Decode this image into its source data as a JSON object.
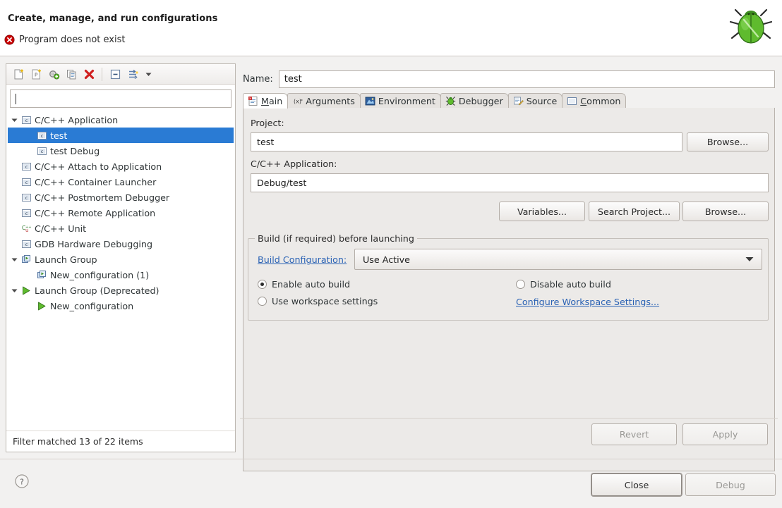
{
  "header": {
    "title": "Create, manage, and run configurations",
    "status_message": "Program does not exist",
    "error_icon": "error-circle-icon",
    "decoration_icon": "green-bug-icon"
  },
  "left_panel": {
    "toolbar": [
      {
        "name": "new-launch-configuration",
        "icon": "new-config-icon",
        "tooltip": "New launch configuration"
      },
      {
        "name": "new-prototype",
        "icon": "new-prototype-icon",
        "tooltip": "New prototype"
      },
      {
        "name": "export-configuration",
        "icon": "link-prototype-icon",
        "tooltip": "Link prototype"
      },
      {
        "name": "duplicate-configuration",
        "icon": "duplicate-icon",
        "tooltip": "Duplicate"
      },
      {
        "name": "delete-configuration",
        "icon": "delete-icon",
        "tooltip": "Delete"
      },
      {
        "name": "collapse-all",
        "icon": "collapse-all-icon",
        "tooltip": "Collapse All"
      },
      {
        "name": "filter-configurations",
        "icon": "filter-icon",
        "tooltip": "Filter"
      },
      {
        "name": "view-menu",
        "icon": "chevron-down-icon",
        "tooltip": "View Menu"
      }
    ],
    "filter_input": {
      "value": "",
      "placeholder": ""
    },
    "tree": [
      {
        "label": "C/C++ Application",
        "icon": "c-app-icon",
        "indent": 0,
        "twisty": "down",
        "selected": false
      },
      {
        "label": "test",
        "icon": "c-app-icon",
        "indent": 1,
        "twisty": "none",
        "selected": true
      },
      {
        "label": "test Debug",
        "icon": "c-app-icon",
        "indent": 1,
        "twisty": "none",
        "selected": false
      },
      {
        "label": "C/C++ Attach to Application",
        "icon": "c-app-icon",
        "indent": 0,
        "twisty": "none",
        "selected": false
      },
      {
        "label": "C/C++ Container Launcher",
        "icon": "c-app-icon",
        "indent": 0,
        "twisty": "none",
        "selected": false
      },
      {
        "label": "C/C++ Postmortem Debugger",
        "icon": "c-app-icon",
        "indent": 0,
        "twisty": "none",
        "selected": false
      },
      {
        "label": "C/C++ Remote Application",
        "icon": "c-app-icon",
        "indent": 0,
        "twisty": "none",
        "selected": false
      },
      {
        "label": "C/C++ Unit",
        "icon": "cunit-icon",
        "indent": 0,
        "twisty": "none",
        "selected": false
      },
      {
        "label": "GDB Hardware Debugging",
        "icon": "c-app-icon",
        "indent": 0,
        "twisty": "none",
        "selected": false
      },
      {
        "label": "Launch Group",
        "icon": "launch-group-icon",
        "indent": 0,
        "twisty": "down",
        "selected": false
      },
      {
        "label": "New_configuration (1)",
        "icon": "launch-group-icon",
        "indent": 1,
        "twisty": "none",
        "selected": false
      },
      {
        "label": "Launch Group (Deprecated)",
        "icon": "run-arrow-icon",
        "indent": 0,
        "twisty": "down",
        "selected": false
      },
      {
        "label": "New_configuration",
        "icon": "run-arrow-icon",
        "indent": 1,
        "twisty": "none",
        "selected": false
      }
    ],
    "status": "Filter matched 13 of 22 items"
  },
  "right_panel": {
    "name_label": "Name:",
    "name_value": "test",
    "tabs": [
      {
        "label": "Main",
        "mnemonic": "M",
        "icon": "main-tab-icon",
        "active": true
      },
      {
        "label": "Arguments",
        "mnemonic": "",
        "icon": "arguments-tab-icon",
        "active": false
      },
      {
        "label": "Environment",
        "mnemonic": "",
        "icon": "environment-tab-icon",
        "active": false
      },
      {
        "label": "Debugger",
        "mnemonic": "",
        "icon": "debugger-tab-icon",
        "active": false
      },
      {
        "label": "Source",
        "mnemonic": "",
        "icon": "source-tab-icon",
        "active": false
      },
      {
        "label": "Common",
        "mnemonic": "C",
        "icon": "common-tab-icon",
        "active": false
      }
    ],
    "main_tab": {
      "project_label": "Project:",
      "project_value": "test",
      "project_browse_label": "Browse...",
      "application_label": "C/C++ Application:",
      "application_value": "Debug/test",
      "variables_label": "Variables...",
      "search_project_label": "Search Project...",
      "app_browse_label": "Browse...",
      "build_group_title": "Build (if required) before launching",
      "build_configuration_link": "Build Configuration:",
      "build_configuration_value": "Use Active",
      "radio_enable_auto_build": "Enable auto build",
      "radio_disable_auto_build": "Disable auto build",
      "radio_use_workspace_settings": "Use workspace settings",
      "configure_workspace_link": "Configure Workspace Settings...",
      "selected_radio": "Enable auto build"
    },
    "revert_label": "Revert",
    "apply_label": "Apply"
  },
  "footer": {
    "help_icon": "help-question-icon",
    "close_label": "Close",
    "debug_label": "Debug"
  },
  "colors": {
    "selection_blue": "#2a7bd4",
    "link_blue": "#2a62b4",
    "error_red": "#cc0000",
    "dialog_bg": "#f2f1f0",
    "panel_bg": "#eceae8",
    "disabled_text": "#9a9996"
  }
}
